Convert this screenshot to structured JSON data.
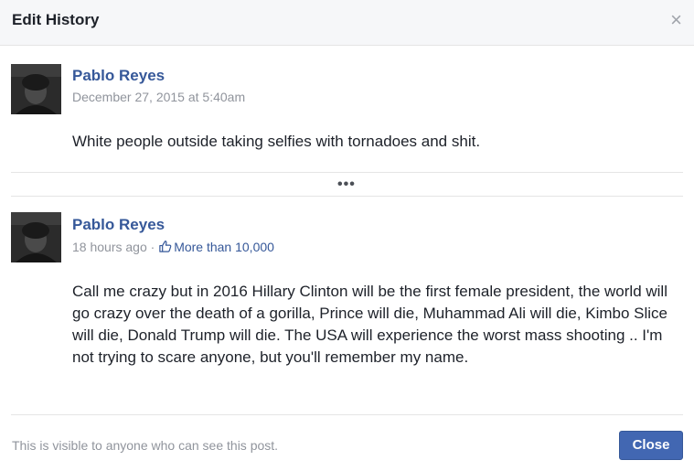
{
  "dialog": {
    "title": "Edit History",
    "close_icon": "×"
  },
  "posts": [
    {
      "author": "Pablo Reyes",
      "timestamp": "December 27, 2015 at 5:40am",
      "text": "White people outside taking selfies with tornadoes and shit."
    },
    {
      "author": "Pablo Reyes",
      "timestamp": "18 hours ago",
      "separator": "·",
      "likes": "More than 10,000",
      "text": "Call me crazy but in 2016 Hillary Clinton will be the first female president, the world will go crazy over the death of a gorilla, Prince will die, Muhammad Ali will die, Kimbo Slice will die, Donald Trump will die. The USA will experience the worst mass shooting .. I'm not trying to scare anyone, but you'll remember my name."
    }
  ],
  "more_indicator": "•••",
  "footer": {
    "visibility_note": "This is visible to anyone who can see this post.",
    "close_label": "Close"
  },
  "colors": {
    "link": "#365899",
    "button": "#4267b2",
    "muted": "#90949c"
  }
}
